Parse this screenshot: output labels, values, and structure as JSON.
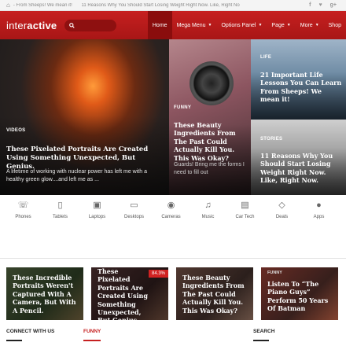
{
  "topbar": {
    "ticker": [
      "- From Sheeps! We mean it!",
      "11 Reasons Why You Should Start Losing Weight Right Now. Like, Right No"
    ],
    "social": [
      "f",
      "♥",
      "g+"
    ]
  },
  "header": {
    "logo_light": "inter",
    "logo_bold": "active",
    "search_placeholder": ""
  },
  "nav": [
    {
      "label": "Home",
      "active": true,
      "dropdown": false
    },
    {
      "label": "Mega Menu",
      "active": false,
      "dropdown": true
    },
    {
      "label": "Options Panel",
      "active": false,
      "dropdown": true
    },
    {
      "label": "Page",
      "active": false,
      "dropdown": true
    },
    {
      "label": "More",
      "active": false,
      "dropdown": true
    },
    {
      "label": "Shop",
      "active": false,
      "dropdown": false
    }
  ],
  "hero": {
    "main": {
      "label": "VIDEOS",
      "title": "These Pixelated Portraits Are Created Using Something Unexpected, But Genius.",
      "excerpt": "A lifetime of working with nuclear power has left me with a healthy green glow....and left me as ..."
    },
    "middle": {
      "label": "FUNNY",
      "title": "These Beauty Ingredients From The Past Could Actually Kill You. This Was Okay?",
      "excerpt": "Guards! Bring me the forms I need to fill out"
    },
    "right_top": {
      "label": "LIFE",
      "title": "21 Important Life Lessons You Can Learn From Sheeps! We mean it!"
    },
    "right_bottom": {
      "label": "STORIES",
      "title": "11 Reasons Why You Should Start Losing Weight Right Now. Like, Right Now."
    }
  },
  "categories": [
    {
      "name": "Phones",
      "icon": "phone-icon"
    },
    {
      "name": "Tablets",
      "icon": "tablet-icon"
    },
    {
      "name": "Laptops",
      "icon": "laptop-icon"
    },
    {
      "name": "Desktops",
      "icon": "desktop-icon"
    },
    {
      "name": "Cameras",
      "icon": "camera-icon"
    },
    {
      "name": "Music",
      "icon": "music-icon"
    },
    {
      "name": "Car Tech",
      "icon": "car-icon"
    },
    {
      "name": "Deals",
      "icon": "diamond-icon"
    },
    {
      "name": "Apps",
      "icon": "apple-icon"
    }
  ],
  "cards": [
    {
      "title": "These Incredible Portraits Weren't Captured With A Camera, But With A Pencil.",
      "badge": "",
      "tag": ""
    },
    {
      "title": "These Pixelated Portraits Are Created Using Something Unexpected, But Genius.",
      "badge": "84.3%",
      "tag": ""
    },
    {
      "title": "These Beauty Ingredients From The Past Could Actually Kill You. This Was Okay?",
      "badge": "",
      "tag": ""
    },
    {
      "title": "Listen To “The Piano Guys” Perform 50 Years Of Batman",
      "badge": "",
      "tag": "FUNNY"
    }
  ],
  "sections": {
    "connect": "CONNECT WITH US",
    "funny": "FUNNY",
    "search": "SEARCH"
  },
  "colors": {
    "brand_red": "#c62020",
    "nav_active": "#8a0d0d"
  }
}
